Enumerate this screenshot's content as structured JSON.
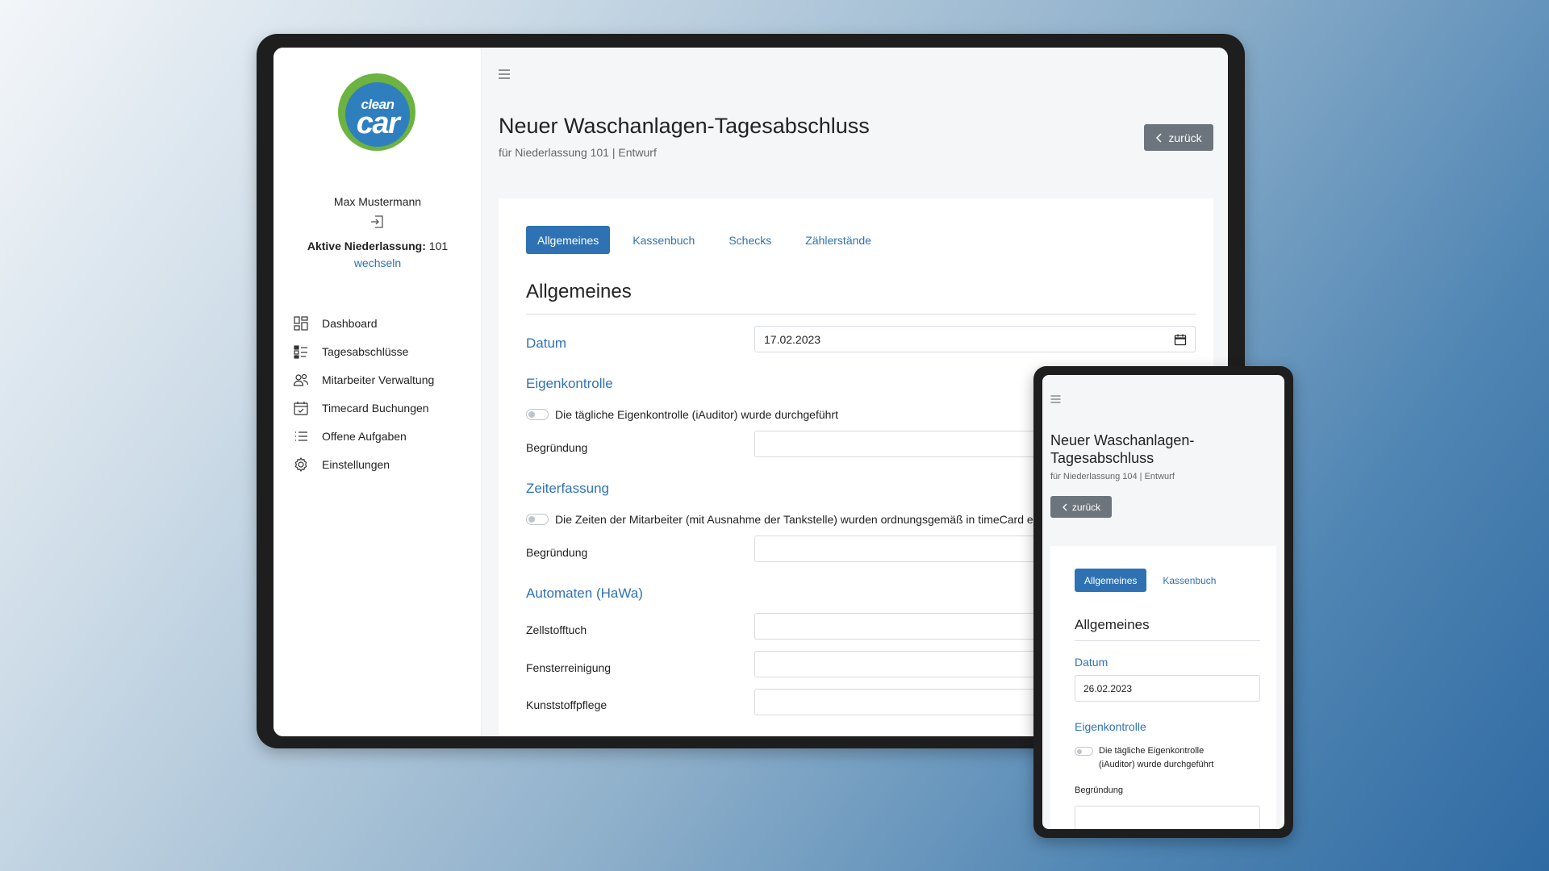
{
  "desktop": {
    "sidebar": {
      "logo_top": "clean",
      "logo_bottom": "car",
      "user_name": "Max Mustermann",
      "active_branch_label": "Aktive Niederlassung:",
      "active_branch_value": "101",
      "switch_link": "wechseln",
      "nav": [
        {
          "label": "Dashboard",
          "icon": "dashboard-icon"
        },
        {
          "label": "Tagesabschlüsse",
          "icon": "checklist-icon"
        },
        {
          "label": "Mitarbeiter Verwaltung",
          "icon": "users-icon"
        },
        {
          "label": "Timecard Buchungen",
          "icon": "calendar-check-icon"
        },
        {
          "label": "Offene Aufgaben",
          "icon": "list-icon"
        },
        {
          "label": "Einstellungen",
          "icon": "gear-icon"
        }
      ]
    },
    "header": {
      "title": "Neuer Waschanlagen-Tagesabschluss",
      "subtitle": "für Niederlassung 101 | Entwurf",
      "back_label": "zurück"
    },
    "tabs": [
      "Allgemeines",
      "Kassenbuch",
      "Schecks",
      "Zählerstände"
    ],
    "active_tab": "Allgemeines",
    "section_title": "Allgemeines",
    "datum_label": "Datum",
    "datum_value": "17.02.2023",
    "eigenkontrolle_label": "Eigenkontrolle",
    "eigenkontrolle_toggle": "Die tägliche Eigenkontrolle (iAuditor) wurde durchgeführt",
    "begruendung_label": "Begründung",
    "zeiterfassung_label": "Zeiterfassung",
    "zeiterfassung_toggle": "Die Zeiten der Mitarbeiter (mit Ausnahme der Tankstelle) wurden ordnungsgemäß in timeCard e",
    "begruendung2_label": "Begründung",
    "automaten_label": "Automaten (HaWa)",
    "automaten_fields": [
      "Zellstofftuch",
      "Fensterreinigung",
      "Kunststoffpflege"
    ]
  },
  "mobile": {
    "title": "Neuer Waschanlagen-Tagesabschluss",
    "subtitle": "für Niederlassung 104 | Entwurf",
    "back_label": "zurück",
    "tabs": [
      "Allgemeines",
      "Kassenbuch"
    ],
    "section_title": "Allgemeines",
    "datum_label": "Datum",
    "datum_value": "26.02.2023",
    "eigenkontrolle_label": "Eigenkontrolle",
    "eigenkontrolle_toggle": "Die tägliche Eigenkontrolle (iAuditor) wurde durchgeführt",
    "begruendung_label": "Begründung"
  },
  "colors": {
    "accent": "#2f72b4",
    "logo_green": "#6cb33f",
    "logo_blue": "#2f7fbf",
    "button_grey": "#6c757d"
  }
}
